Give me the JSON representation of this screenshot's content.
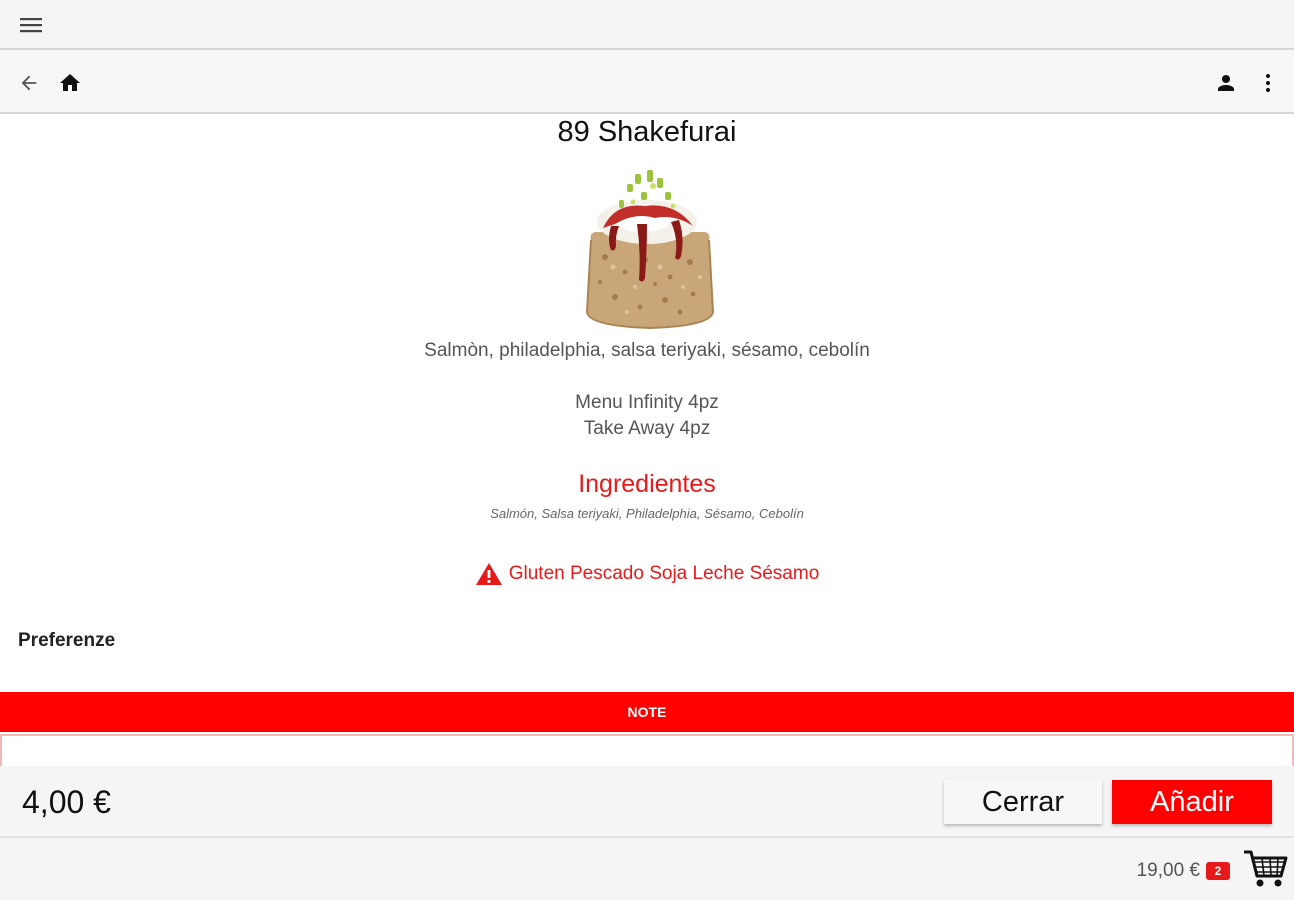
{
  "icons": {
    "menu": "hamburger-menu-icon",
    "back": "arrow-left-icon",
    "home": "home-icon",
    "account": "person-icon",
    "more": "more-vertical-icon",
    "warning": "warning-triangle-icon",
    "cart": "shopping-cart-icon"
  },
  "colors": {
    "accent": "#ff0000",
    "accent_text": "#e8191b",
    "bar_bg": "#f5f5f5"
  },
  "product": {
    "title": "89 Shakefurai",
    "description": "Salmòn, philadelphia, salsa teriyaki, sésamo, cebolín",
    "menu_info": [
      "Menu Infinity 4pz",
      "Take Away 4pz"
    ],
    "ingredients_title": "Ingredientes",
    "ingredients_list": "Salmón, Salsa teriyaki, Philadelphia, Sésamo, Cebolín",
    "allergens": "Gluten Pescado Soja Leche Sésamo"
  },
  "preferences": {
    "label": "Preferenze"
  },
  "note": {
    "label": "NOTE",
    "value": ""
  },
  "actions": {
    "price": "4,00 €",
    "close_label": "Cerrar",
    "add_label": "Añadir"
  },
  "cart": {
    "total": "19,00 €",
    "count": "2"
  }
}
